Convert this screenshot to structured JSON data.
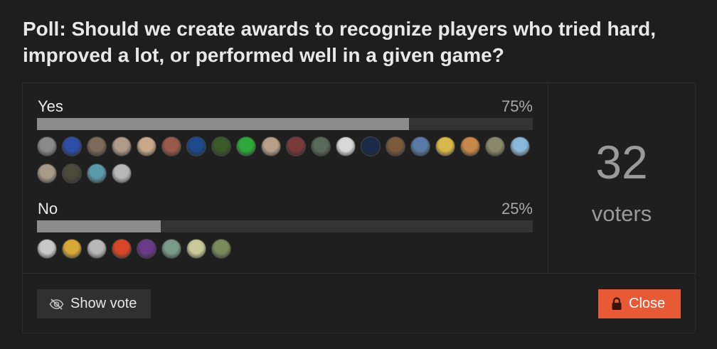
{
  "poll": {
    "title": "Poll: Should we create awards to recognize players who tried hard, improved a lot, or performed well in a given game?",
    "options": [
      {
        "label": "Yes",
        "percent_text": "75%",
        "fraction": 0.75,
        "avatar_colors": [
          "#8a8a8a",
          "#2d4ea8",
          "#7d6a5a",
          "#b09a8a",
          "#c8a888",
          "#9a5a4a",
          "#1c4a8a",
          "#3a5a2a",
          "#2ea83a",
          "#b8a088",
          "#7a3a3a",
          "#5a6a5a",
          "#d8d8d8",
          "#1a2a4a",
          "#7a5a3a",
          "#5a7aa8",
          "#d8b848",
          "#c88848",
          "#8a8a6a",
          "#8ab8d8",
          "#a89a88",
          "#4a4a3a",
          "#5a9aa8",
          "#b8b8b8"
        ]
      },
      {
        "label": "No",
        "percent_text": "25%",
        "fraction": 0.25,
        "avatar_colors": [
          "#c8c8c8",
          "#d8a838",
          "#b8b8b8",
          "#d84828",
          "#6a3a8a",
          "#7a9a8a",
          "#c8c898",
          "#7a8a5a"
        ]
      }
    ]
  },
  "voters": {
    "count": "32",
    "label": "voters"
  },
  "buttons": {
    "show_vote": "Show vote",
    "close": "Close"
  },
  "colors": {
    "accent": "#e85a35",
    "bar_fill": "#8c8c8c",
    "bar_track": "#333333"
  },
  "icons": {
    "show_vote": "eye-slash-icon",
    "close": "lock-icon"
  }
}
